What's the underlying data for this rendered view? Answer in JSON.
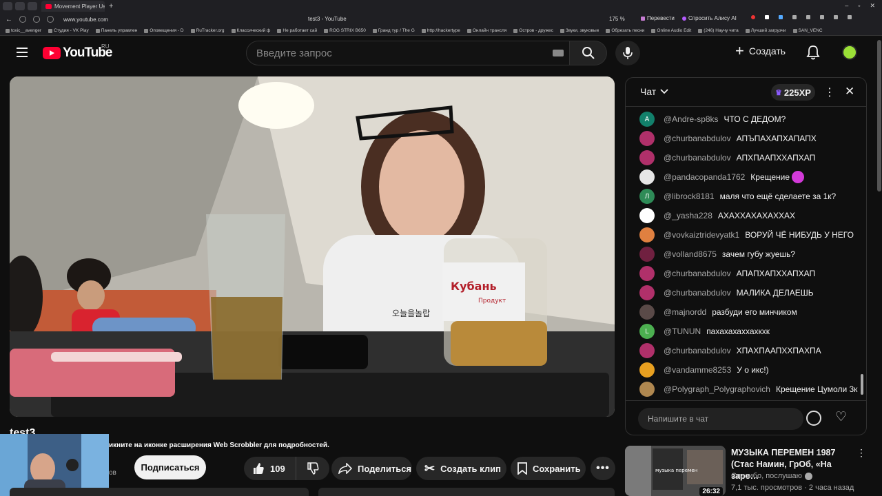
{
  "browser": {
    "tab_title": "Movement Player Uses Ne",
    "url": "www.youtube.com",
    "page_title": "test3 - YouTube",
    "zoom": "175 %",
    "translate": "Перевести",
    "ask_alice": "Спросить Алису AI",
    "bookmarks": [
      "toxic__avenger",
      "Студия - VK Play",
      "Панель управлен",
      "Оповещения - D",
      "RuTracker.org",
      "Классический ф",
      "Не работает сай",
      "ROG STRIX B650",
      "Гранд тур / The G",
      "http://hackertype",
      "Онлайн трансля",
      "Остров - дружес",
      "Звуки, звуковые",
      "Обрезать песни",
      "Online Audio Edit",
      "(246) Научу чита",
      "Лучший загрузчи",
      "SAN_VENC"
    ]
  },
  "header": {
    "logo_text": "YouTube",
    "region": "RU",
    "search_placeholder": "Введите запрос",
    "create_label": "Создать"
  },
  "video": {
    "title": "test3",
    "scrobbler_notice": "икните на иконке расширения Web Scrobbler для подробностей.",
    "channel_rest": "ов",
    "subscribe_label": "Подписаться",
    "likes": "109",
    "share_label": "Поделиться",
    "clip_label": "Создать клип",
    "save_label": "Сохранить",
    "scene": {
      "shirt_text": "오늘을놀랍",
      "jar_brand": "Кубань",
      "jar_sub": "Продукт"
    }
  },
  "chat": {
    "title": "Чат",
    "xp": "225XP",
    "input_placeholder": "Напишите в чат",
    "messages": [
      {
        "author": "@Andre-sp8ks",
        "text": "ЧТО С ДЕДОМ?",
        "avatar_letter": "A",
        "avatar_color": "#12806b"
      },
      {
        "author": "@churbanabdulov",
        "text": "АПЪПАХАПХАПАПХ",
        "avatar_letter": "",
        "avatar_color": "#b0306a"
      },
      {
        "author": "@churbanabdulov",
        "text": "АПХПААПХХАПХАП",
        "avatar_letter": "",
        "avatar_color": "#b0306a"
      },
      {
        "author": "@pandacopanda1762",
        "text": "Крещение",
        "avatar_letter": "",
        "avatar_color": "#e6e6e6",
        "emoji": true
      },
      {
        "author": "@librock8181",
        "text": "маля что ещё сделаете за 1к?",
        "avatar_letter": "Л",
        "avatar_color": "#2e8b57"
      },
      {
        "author": "@_yasha228",
        "text": "АХАХХАХАХАХХАХ",
        "avatar_letter": "",
        "avatar_color": "#ffffff"
      },
      {
        "author": "@vovkaiztridevyatk1",
        "text": "ВОРУЙ ЧЁ НИБУДЬ У НЕГО",
        "avatar_letter": "",
        "avatar_color": "#e08040"
      },
      {
        "author": "@volland8675",
        "text": "зачем губу жуешь?",
        "avatar_letter": "",
        "avatar_color": "#702040"
      },
      {
        "author": "@churbanabdulov",
        "text": "АПАПХАПХХАПХАП",
        "avatar_letter": "",
        "avatar_color": "#b0306a"
      },
      {
        "author": "@churbanabdulov",
        "text": "МАЛИКА ДЕЛАЕШЬ",
        "avatar_letter": "",
        "avatar_color": "#b0306a"
      },
      {
        "author": "@majnordd",
        "text": "разбуди его минчиком",
        "avatar_letter": "",
        "avatar_color": "#5a4a48"
      },
      {
        "author": "@TUNUN",
        "text": "пахахахаххахкхк",
        "avatar_letter": "L",
        "avatar_color": "#4caf50"
      },
      {
        "author": "@churbanabdulov",
        "text": "ХПАХПААПХХПАХПА",
        "avatar_letter": "",
        "avatar_color": "#b0306a"
      },
      {
        "author": "@vandamme8253",
        "text": "У о икс!)",
        "avatar_letter": "",
        "avatar_color": "#e8a020"
      },
      {
        "author": "@Polygraph_Polygraphovich",
        "text": "Крещение Цумоли 3к",
        "avatar_letter": "",
        "avatar_color": "#b08850"
      }
    ]
  },
  "recommendation": {
    "title": "МУЗЫКА ПЕРЕМЕН 1987 (Стас Намин, ГрОб, «На заре…",
    "channel": "Спасибо, послушаю",
    "meta": "7,1 тыс. просмотров · 2 часа назад",
    "duration": "26:32",
    "thumb_text": "музыка перемен"
  },
  "colors": {
    "yt_red": "#ff0033",
    "bg": "#0f0f0f",
    "pill": "#272727",
    "xp_crown": "#8c5bff"
  }
}
